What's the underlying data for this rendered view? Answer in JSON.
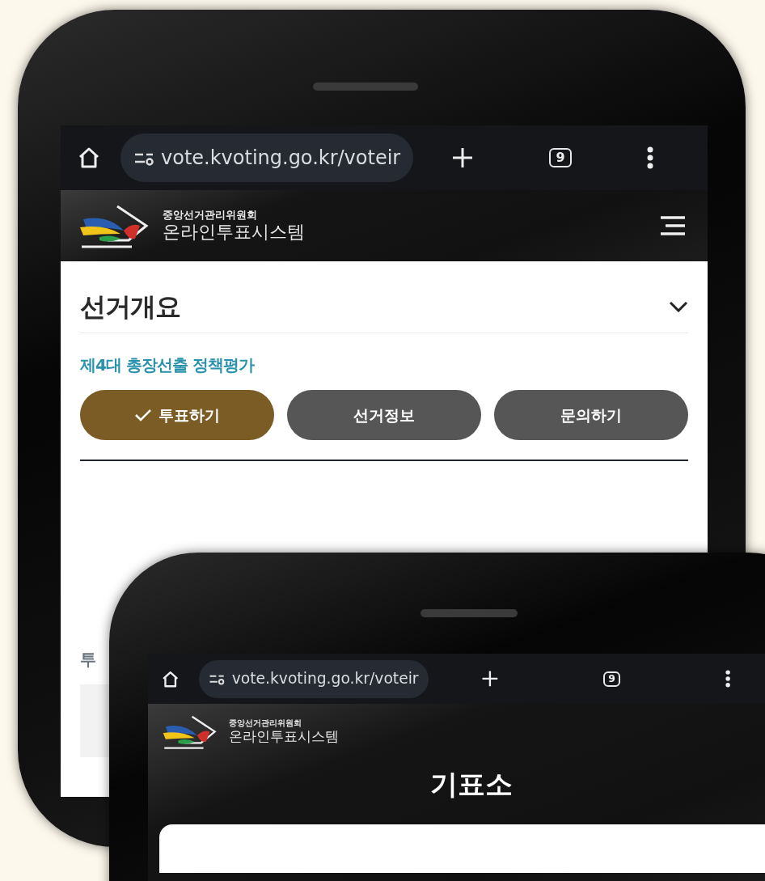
{
  "back_phone": {
    "browser": {
      "url": "vote.kvoting.go.kr/voteir",
      "tab_count": "9"
    },
    "header": {
      "org": "중앙선거관리위원회",
      "system": "온라인투표시스템"
    },
    "section_title": "선거개요",
    "election_name": "제4대 총장선출 정책평가",
    "actions": [
      {
        "label": "투표하기",
        "selected": true
      },
      {
        "label": "선거정보",
        "selected": false
      },
      {
        "label": "문의하기",
        "selected": false
      }
    ],
    "partial_text": "투"
  },
  "front_phone": {
    "browser": {
      "url": "vote.kvoting.go.kr/voteir",
      "tab_count": "9"
    },
    "header": {
      "org": "중앙선거관리위원회",
      "system": "온라인투표시스템"
    },
    "page_title": "기표소"
  }
}
